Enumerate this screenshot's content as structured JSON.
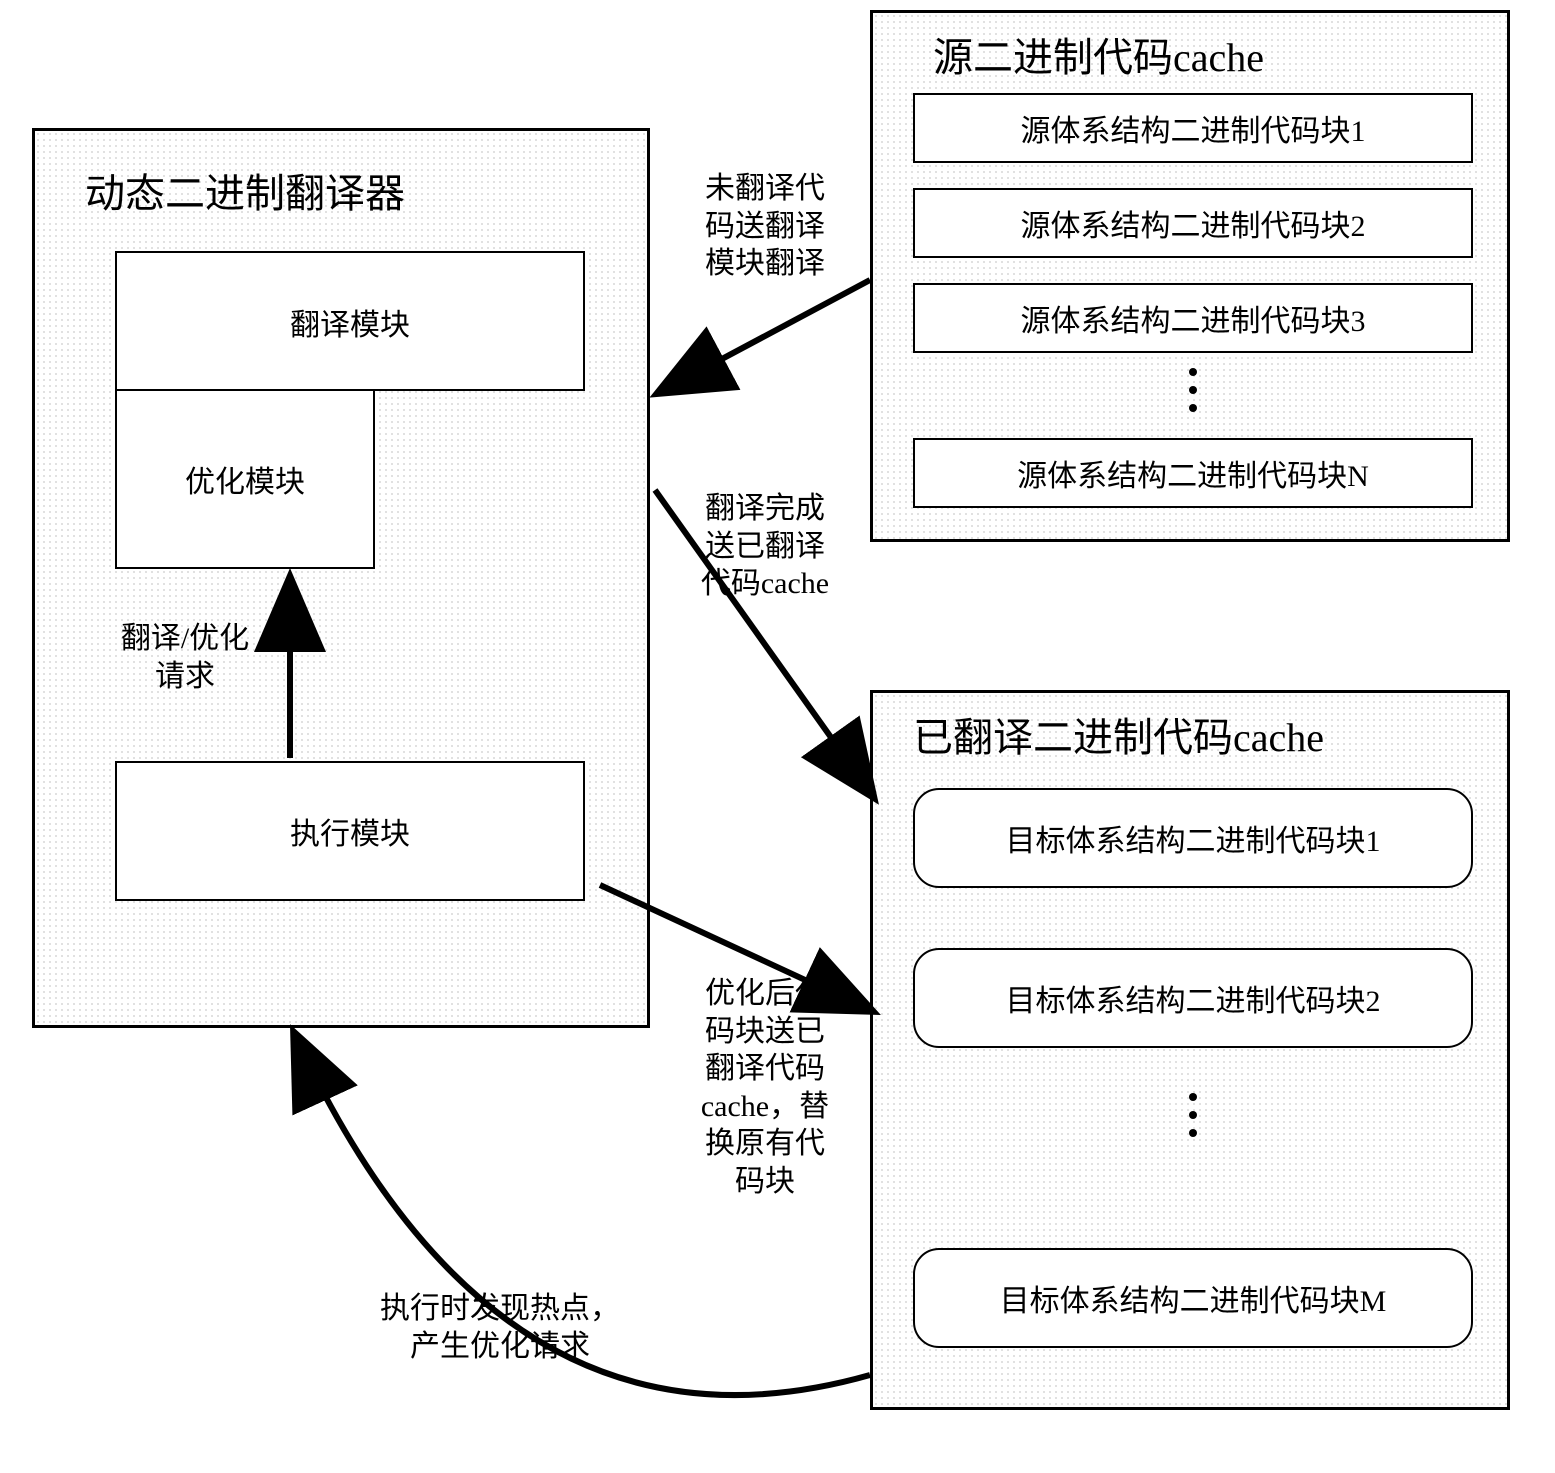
{
  "translator": {
    "title": "动态二进制翻译器",
    "translate_module": "翻译模块",
    "optimize_module": "优化模块",
    "exec_module": "执行模块",
    "req_label": "翻译/优化\n请求"
  },
  "source_cache": {
    "title": "源二进制代码cache",
    "block1": "源体系结构二进制代码块1",
    "block2": "源体系结构二进制代码块2",
    "block3": "源体系结构二进制代码块3",
    "blockN": "源体系结构二进制代码块N"
  },
  "translated_cache": {
    "title": "已翻译二进制代码cache",
    "block1": "目标体系结构二进制代码块1",
    "block2": "目标体系结构二进制代码块2",
    "blockM": "目标体系结构二进制代码块M"
  },
  "edges": {
    "untranslated": "未翻译代\n码送翻译\n模块翻译",
    "done_translate": "翻译完成\n送已翻译\n代码cache",
    "optimized_replace": "优化后代\n码块送已\n翻译代码\ncache，替\n换原有代\n码块",
    "hotspot": "执行时发现热点，\n产生优化请求"
  }
}
